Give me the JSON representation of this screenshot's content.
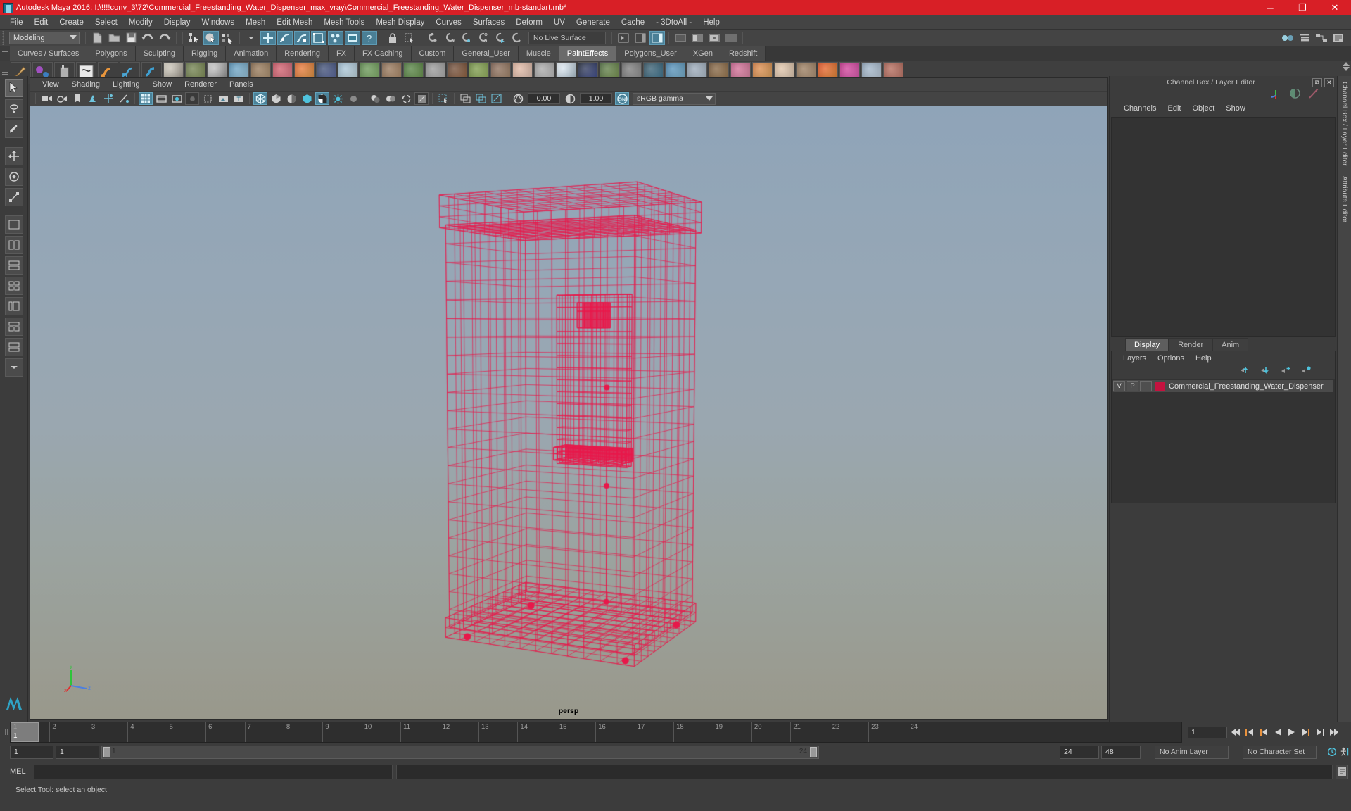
{
  "titlebar": {
    "title": "Autodesk Maya 2016: I:\\!!!!conv_3\\72\\Commercial_Freestanding_Water_Dispenser_max_vray\\Commercial_Freestanding_Water_Dispenser_mb-standart.mb*",
    "minimize": "─",
    "maximize": "❐",
    "close": "✕",
    "accent_color": "#d81f26"
  },
  "menubar": {
    "items": [
      "File",
      "Edit",
      "Create",
      "Select",
      "Modify",
      "Display",
      "Windows",
      "Mesh",
      "Edit Mesh",
      "Mesh Tools",
      "Mesh Display",
      "Curves",
      "Surfaces",
      "Deform",
      "UV",
      "Generate",
      "Cache",
      "- 3DtoAll -",
      "Help"
    ]
  },
  "statusline": {
    "menu_set": "Modeling",
    "live_surface": "No Live Surface",
    "icons": [
      "new-scene-icon",
      "open-scene-icon",
      "save-scene-icon",
      "undo-icon",
      "redo-icon",
      "select-hierarchy-icon",
      "select-object-icon",
      "select-component-icon",
      "snap-grid-icon",
      "snap-curve-icon",
      "snap-point-icon",
      "snap-projectcenter-icon",
      "snap-view-plane-icon",
      "make-live-icon",
      "lock-icon",
      "render-current-frame-icon",
      "ipr-render-icon",
      "render-settings-icon",
      "hypershade-icon",
      "outliner-icon",
      "node-editor-icon",
      "attribute-editor-toggle-icon",
      "tool-settings-toggle-icon",
      "channel-box-toggle-icon"
    ]
  },
  "shelf": {
    "tabs": [
      "Curves / Surfaces",
      "Polygons",
      "Sculpting",
      "Rigging",
      "Animation",
      "Rendering",
      "FX",
      "FX Caching",
      "Custom",
      "General_User",
      "Muscle",
      "PaintEffects",
      "Polygons_User",
      "XGen",
      "Redshift"
    ],
    "active_tab": "PaintEffects",
    "buttons": [
      "paint-brush-icon",
      "paint-blend-icon",
      "paint-can-icon",
      "template-brush-icon",
      "curve-stroke-icon",
      "curve-stroke-edit-icon",
      "curve-attach-icon",
      "pottery-preset-icon",
      "grass-preset-icon",
      "stone-preset-icon",
      "crystal-preset-icon",
      "feather-preset-icon",
      "flower-preset-icon",
      "fire-preset-icon",
      "galaxy-preset-icon",
      "glass-preset-icon",
      "grasses-preset-icon",
      "hair-preset-icon",
      "leaf-preset-icon",
      "metal-preset-icon",
      "oil-preset-icon",
      "plant-preset-icon",
      "rock-preset-icon",
      "skin-preset-icon",
      "smoke-preset-icon",
      "snow-preset-icon",
      "space-preset-icon",
      "tree-preset-icon",
      "tube-preset-icon",
      "underwater-preset-icon",
      "water-preset-icon",
      "weather-preset-icon",
      "wood-preset-icon",
      "fun-preset-icon",
      "food-preset-icon",
      "hands-preset-icon",
      "fur-preset-icon",
      "flames-preset-icon",
      "fireworks-preset-icon",
      "clouds-preset-icon",
      "bricks-preset-icon"
    ]
  },
  "toolbox": {
    "tools": [
      "select-tool",
      "lasso-select-tool",
      "paint-select-tool",
      "move-tool",
      "rotate-tool",
      "scale-tool",
      "last-tool",
      "quick-layout-single",
      "quick-layout-four",
      "quick-layout-two-stacked",
      "quick-layout-outliner-persp",
      "quick-layout-persp-graph",
      "quick-layout-hypershade",
      "quick-layout-uv",
      "quick-layout-more"
    ],
    "selected": "select-tool"
  },
  "viewport": {
    "menus": [
      "View",
      "Shading",
      "Lighting",
      "Show",
      "Renderer",
      "Panels"
    ],
    "camera_label": "persp",
    "exposure": "0.00",
    "gamma": "1.00",
    "color_management": "sRGB gamma",
    "view_transform_enabled": "ON",
    "toolbar_icons": [
      "select-camera-icon",
      "lock-camera-icon",
      "camera-attributes-icon",
      "bookmark-icon",
      "image-plane-icon",
      "two-sided-lighting-icon",
      "shadows-icon",
      "grid-toggle-icon",
      "film-gate-icon",
      "resolution-gate-icon",
      "gate-mask-icon",
      "xray-icon",
      "xray-joints-icon",
      "texture-toggle-icon",
      "wireframe-shaded-icon",
      "smooth-shade-all-icon",
      "flat-shade-icon",
      "wireframe-on-shaded-icon",
      "xray-mode-icon",
      "use-default-light-icon",
      "use-all-lights-icon",
      "shadow-toggle-icon",
      "screen-space-ao-icon",
      "motion-blur-icon",
      "multisample-icon",
      "isolate-select-icon"
    ],
    "background_top": "#8fa4b8",
    "background_bottom": "#99988b",
    "wire_color": "#e8184a"
  },
  "channel_box": {
    "title": "Channel Box / Layer Editor",
    "menus": [
      "Channels",
      "Edit",
      "Object",
      "Show"
    ],
    "float_button": "⧉",
    "close_button": "✕",
    "side_tabs": [
      "Channel Box / Layer Editor",
      "Attribute Editor"
    ],
    "header_icons": [
      "axis-gizmo-icon",
      "sphere-shading-icon",
      "paint-stroke-icon"
    ]
  },
  "layer_editor": {
    "tabs": [
      "Display",
      "Render",
      "Anim"
    ],
    "active_tab": "Display",
    "menus": [
      "Layers",
      "Options",
      "Help"
    ],
    "tool_icons": [
      "move-layer-up-icon",
      "move-layer-down-icon",
      "new-layer-icon",
      "new-layer-from-selected-icon"
    ],
    "layers": [
      {
        "visibility": "V",
        "playback": "P",
        "shading": "",
        "color": "#c4123f",
        "name": "Commercial_Freestanding_Water_Dispenser"
      }
    ]
  },
  "timeline": {
    "ticks": [
      "1",
      "2",
      "3",
      "4",
      "5",
      "6",
      "7",
      "8",
      "9",
      "10",
      "11",
      "12",
      "13",
      "14",
      "15",
      "16",
      "17",
      "18",
      "19",
      "20",
      "21",
      "22",
      "23",
      "24"
    ],
    "current_frame": "1",
    "current_frame_field": "1",
    "playback_icons": [
      "go-to-start-icon",
      "step-back-keyframe-icon",
      "step-back-frame-icon",
      "play-backwards-icon",
      "play-forwards-icon",
      "step-forward-frame-icon",
      "step-forward-keyframe-icon",
      "go-to-end-icon"
    ]
  },
  "rangeslider": {
    "start_field": "1",
    "end_field": "1",
    "range_start_label": "1",
    "range_end_label": "24",
    "anim_start": "24",
    "anim_end": "48",
    "anim_layer": "No Anim Layer",
    "character_set": "No Character Set",
    "auto_key_icon": "auto-keyframe-icon",
    "anim_prefs_icon": "animation-preferences-icon"
  },
  "command_line": {
    "label": "MEL",
    "input_value": "",
    "output_value": "",
    "script_editor_icon": "script-editor-icon"
  },
  "help_line": {
    "text": "Select Tool: select an object"
  }
}
